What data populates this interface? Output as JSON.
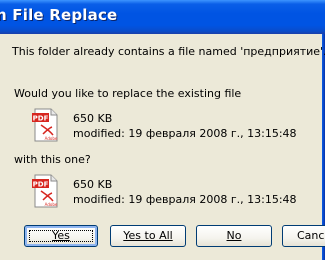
{
  "window": {
    "title": "n File Replace"
  },
  "message": {
    "already_contains": "This folder already contains a file named 'предприятие'.",
    "replace_question": "Would you like to replace the existing file",
    "with_this_one": "with this one?"
  },
  "existing_file": {
    "size": "650 KB",
    "modified": "modified: 19 февраля 2008 г., 13:15:48"
  },
  "new_file": {
    "size": "650 KB",
    "modified": "modified: 19 февраля 2008 г., 13:15:48"
  },
  "buttons": {
    "yes": "Yes",
    "yes_to_all": "Yes to All",
    "no": "No",
    "cancel": "Canc"
  },
  "icons": {
    "file_icon": "pdf-file-icon",
    "pdf_label": "PDF",
    "adobe_label": "Adobe"
  },
  "colors": {
    "titlebar": "#0054e3",
    "dialog_bg": "#ece9d8",
    "pdf_red": "#d7261f"
  }
}
